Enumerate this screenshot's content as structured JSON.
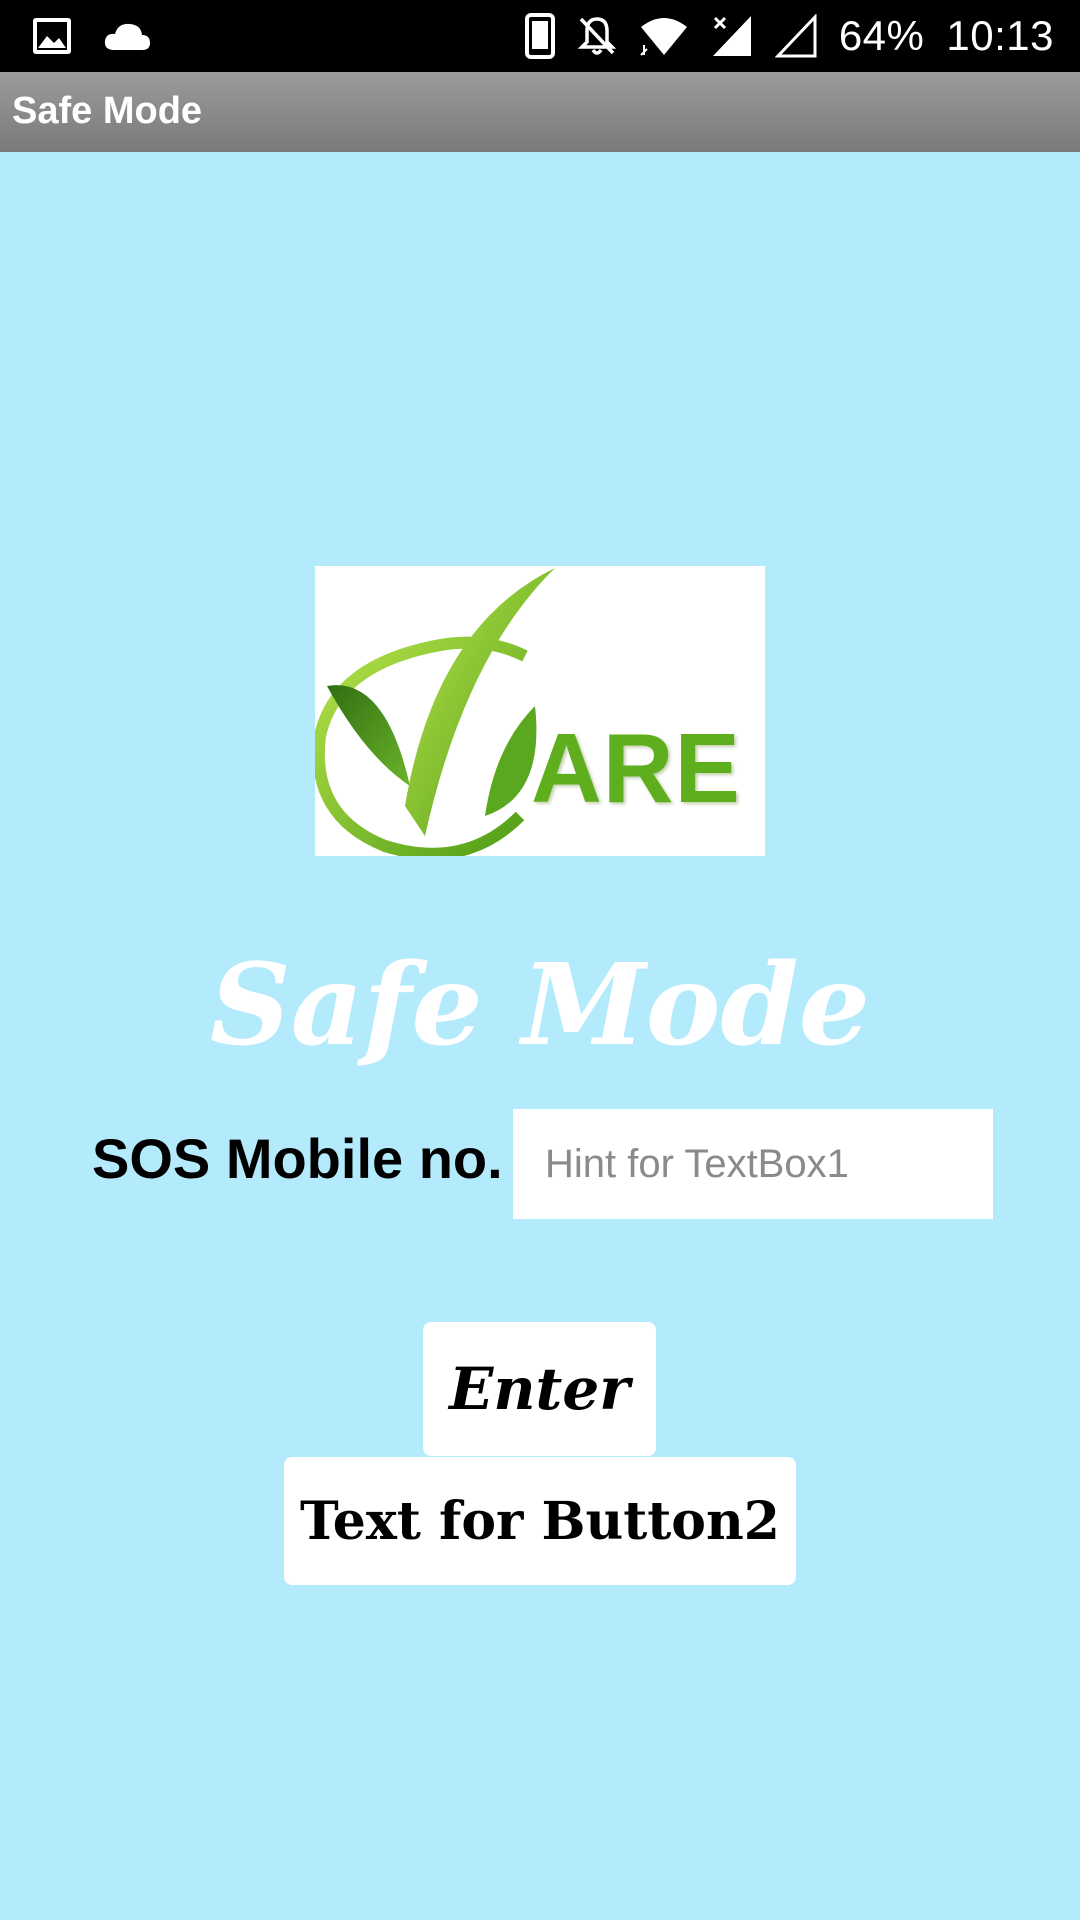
{
  "status_bar": {
    "left_icons": [
      "image-icon",
      "cloud-icon"
    ],
    "right_icons": [
      "phone-icon",
      "bell-off-icon",
      "wifi-icon",
      "signal-icon",
      "signal-empty-icon"
    ],
    "battery": "64%",
    "time": "10:13"
  },
  "app_bar": {
    "title": "Safe Mode"
  },
  "logo": {
    "text": "ARE",
    "colors": {
      "green_light": "#8fd13a",
      "green_dark": "#3d8a12"
    }
  },
  "main": {
    "heading": "Safe Mode",
    "sos_label": "SOS Mobile no.",
    "sos_input": {
      "value": "",
      "placeholder": "Hint for TextBox1"
    },
    "enter_button": "Enter",
    "button2": "Text for Button2"
  },
  "colors": {
    "background": "#b3eafc",
    "title_bar": "#8a8a8a",
    "status_bar": "#000000"
  }
}
